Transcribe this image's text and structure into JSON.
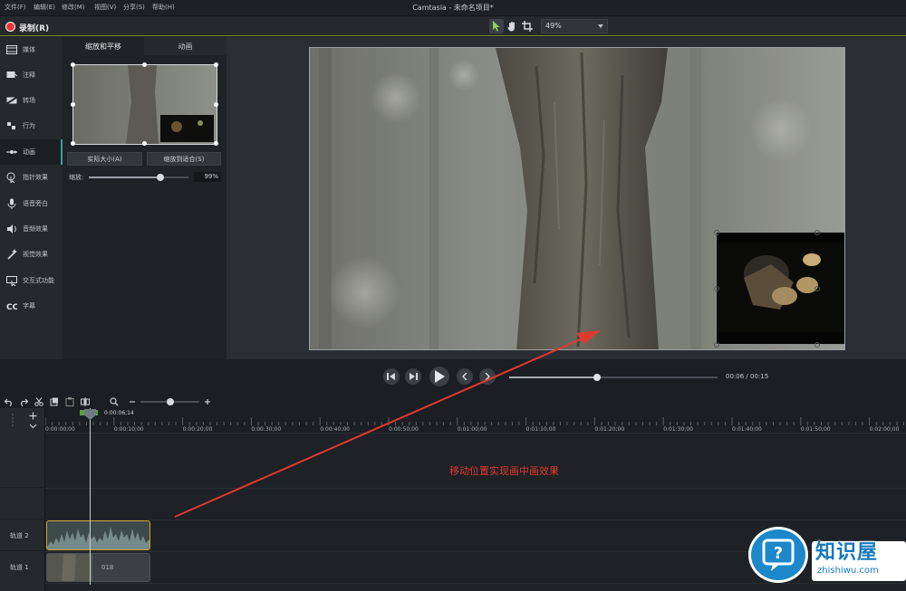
{
  "menu": {
    "items": [
      "文件(F)",
      "编辑(E)",
      "修改(M)",
      "视图(V)",
      "分享(S)",
      "帮助(H)"
    ],
    "app_title": "Camtasia - 未命名项目*"
  },
  "toolbar": {
    "record_label": "录制(R)",
    "zoom_value": "49%",
    "icons": [
      "pointer-icon",
      "hand-icon",
      "crop-icon"
    ]
  },
  "sidebar": {
    "items": [
      {
        "label": "媒体",
        "icon": "media-icon"
      },
      {
        "label": "注释",
        "icon": "annotation-icon"
      },
      {
        "label": "转场",
        "icon": "transition-icon"
      },
      {
        "label": "行为",
        "icon": "behavior-icon"
      },
      {
        "label": "动画",
        "icon": "animation-icon",
        "active": true
      },
      {
        "label": "指针效果",
        "icon": "cursor-effect-icon"
      },
      {
        "label": "语音旁白",
        "icon": "microphone-icon"
      },
      {
        "label": "音频效果",
        "icon": "speaker-icon"
      },
      {
        "label": "视觉效果",
        "icon": "magic-wand-icon"
      },
      {
        "label": "交互式功能",
        "icon": "interactive-icon"
      },
      {
        "label": "字幕",
        "icon": "cc-icon"
      }
    ]
  },
  "props": {
    "tab_scale": "缩放和平移",
    "tab_animation": "动画",
    "btn_actual_size": "实际大小(A)",
    "btn_fit": "缩放到适合(S)",
    "scale_label": "缩放:",
    "scale_value": "99%",
    "scale_fraction": 0.72
  },
  "playback": {
    "current_time": "00:06",
    "separator": "/",
    "total_time": "00:15",
    "progress_fraction": 0.42
  },
  "timeline": {
    "playhead_time": "0:00:06;14",
    "zoom_fraction": 0.5,
    "ticks": [
      "0:00:00;00",
      "0:00:10;00",
      "0:00:20;00",
      "0:00:30;00",
      "0:00:40;00",
      "0:00:50;00",
      "0:01:00;00",
      "0:01:10;00",
      "0:01:20;00",
      "0:01:30;00",
      "0:01:40;00",
      "0:01:50;00",
      "0:02:00;00"
    ],
    "tracks": [
      {
        "label": "轨道 2"
      },
      {
        "label": "轨道 1"
      }
    ],
    "clip_video_label": "018"
  },
  "annotation": {
    "text": "移动位置实现画中画效果",
    "color": "#e03a2e"
  },
  "watermark": {
    "title": "知识屋",
    "url": "zhishiwu.com"
  }
}
